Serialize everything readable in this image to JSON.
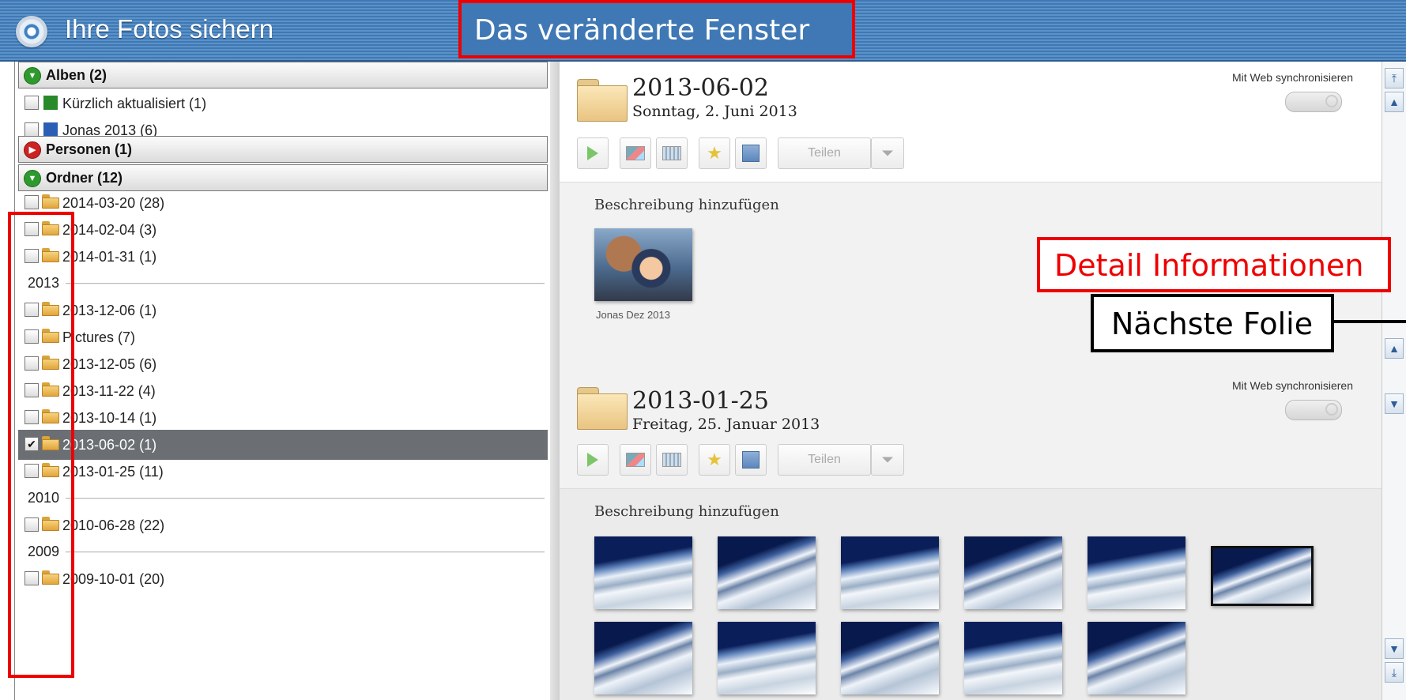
{
  "window": {
    "title": "Ihre Fotos sichern"
  },
  "annotations": {
    "top": "Das veränderte Fenster",
    "detail": "Detail Informationen",
    "next": "Nächste Folie"
  },
  "sidebar": {
    "albums_header": "Alben (2)",
    "albums": [
      {
        "label": "Kürzlich aktualisiert (1)",
        "icon": "green-album-icon"
      },
      {
        "label": "Jonas 2013 (6)",
        "icon": "blue-album-icon"
      }
    ],
    "persons_header": "Personen (1)",
    "folders_header": "Ordner (12)",
    "folders": [
      {
        "label": "2014-03-20 (28)",
        "checked": false
      },
      {
        "label": "2014-02-04 (3)",
        "checked": false
      },
      {
        "label": "2014-01-31 (1)",
        "checked": false
      },
      {
        "year": "2013"
      },
      {
        "label": "2013-12-06 (1)",
        "checked": false
      },
      {
        "label": "Pictures (7)",
        "checked": false
      },
      {
        "label": "2013-12-05 (6)",
        "checked": false
      },
      {
        "label": "2013-11-22 (4)",
        "checked": false
      },
      {
        "label": "2013-10-14 (1)",
        "checked": false
      },
      {
        "label": "2013-06-02 (1)",
        "checked": true
      },
      {
        "label": "2013-01-25 (11)",
        "checked": false
      },
      {
        "year": "2010"
      },
      {
        "label": "2010-06-28 (22)",
        "checked": false
      },
      {
        "year": "2009"
      },
      {
        "label": "2009-10-01 (20)",
        "checked": false
      }
    ]
  },
  "events": [
    {
      "title": "2013-06-02",
      "date": "Sonntag, 2. Juni 2013",
      "sync_label": "Mit Web synchronisieren",
      "share_label": "Teilen",
      "description_placeholder": "Beschreibung hinzufügen",
      "photos": [
        {
          "caption": "Jonas Dez 2013"
        }
      ]
    },
    {
      "title": "2013-01-25",
      "date": "Freitag, 25. Januar 2013",
      "sync_label": "Mit Web synchronisieren",
      "share_label": "Teilen",
      "description_placeholder": "Beschreibung hinzufügen",
      "photos": [
        {},
        {},
        {},
        {},
        {},
        {},
        {},
        {},
        {},
        {},
        {}
      ]
    }
  ]
}
